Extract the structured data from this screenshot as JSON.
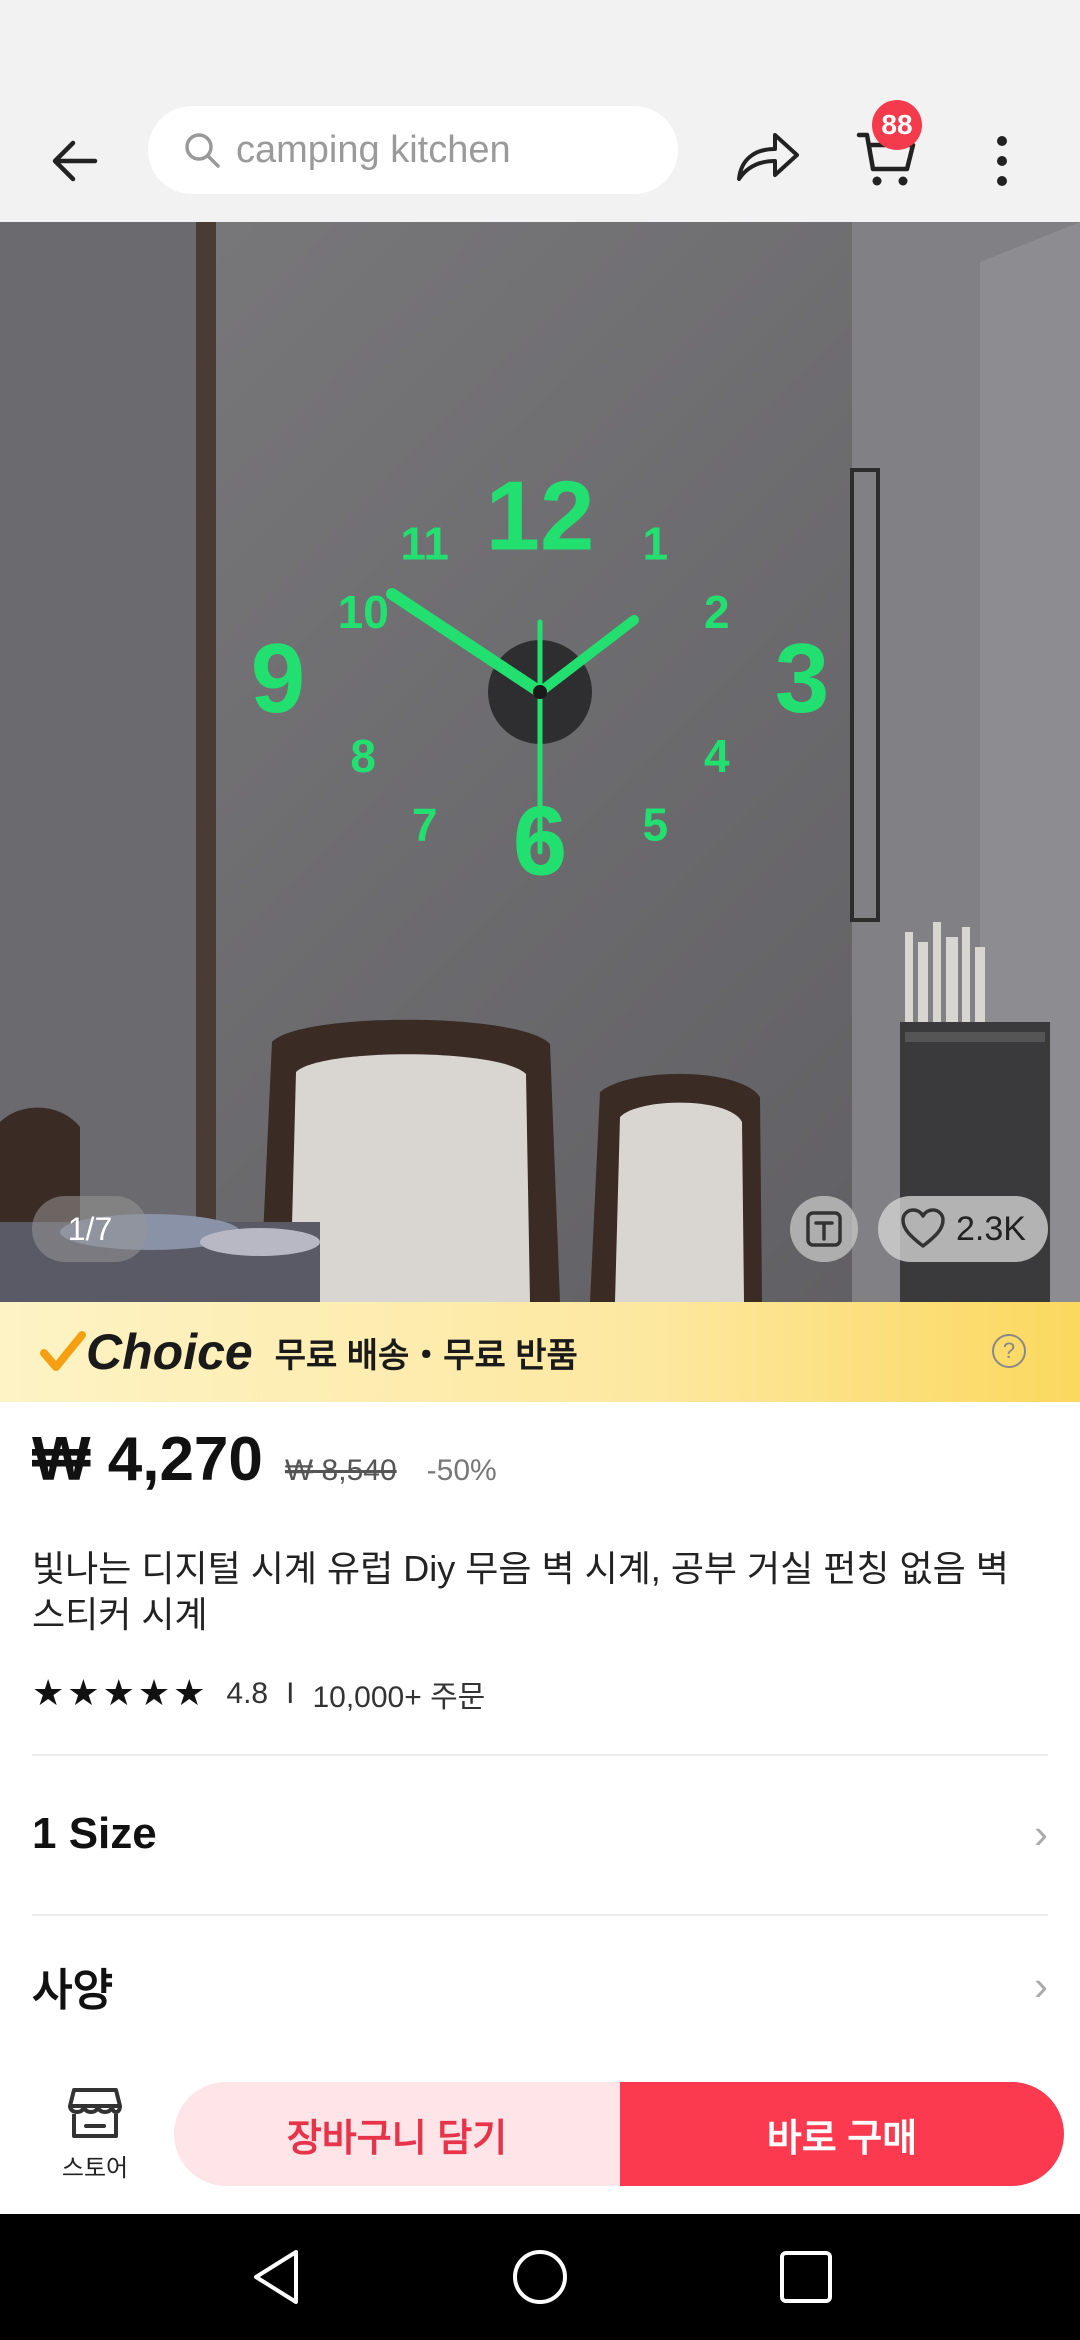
{
  "header": {
    "search_placeholder": "camping kitchen",
    "cart_count": "88"
  },
  "gallery": {
    "counter": "1/7",
    "wishlist_count": "2.3K",
    "clock_numbers": [
      "12",
      "1",
      "2",
      "3",
      "4",
      "5",
      "6",
      "7",
      "8",
      "9",
      "10",
      "11"
    ]
  },
  "choice": {
    "logo_text": "Choice",
    "tagline": "무료 배송・무료 반품",
    "help": "?"
  },
  "product": {
    "price": "₩ 4,270",
    "original_price": "₩ 8,540",
    "discount": "-50%",
    "title": "빛나는 디지털 시계 유럽 Diy 무음 벽 시계, 공부 거실 펀칭 없음 벽 스티커 시계",
    "rating": "4.8",
    "rating_stars": 5,
    "separator": "I",
    "orders": "10,000+ 주문"
  },
  "options": [
    {
      "label": "1 Size"
    },
    {
      "label": "사양"
    }
  ],
  "bottom_bar": {
    "store_label": "스토어",
    "add_to_cart": "장바구니 담기",
    "buy_now": "바로 구매"
  },
  "colors": {
    "accent_red": "#fb3a4f",
    "badge_red": "#f43b4b",
    "clock_green": "#22e070",
    "choice_yellow": "#fde8a0"
  }
}
